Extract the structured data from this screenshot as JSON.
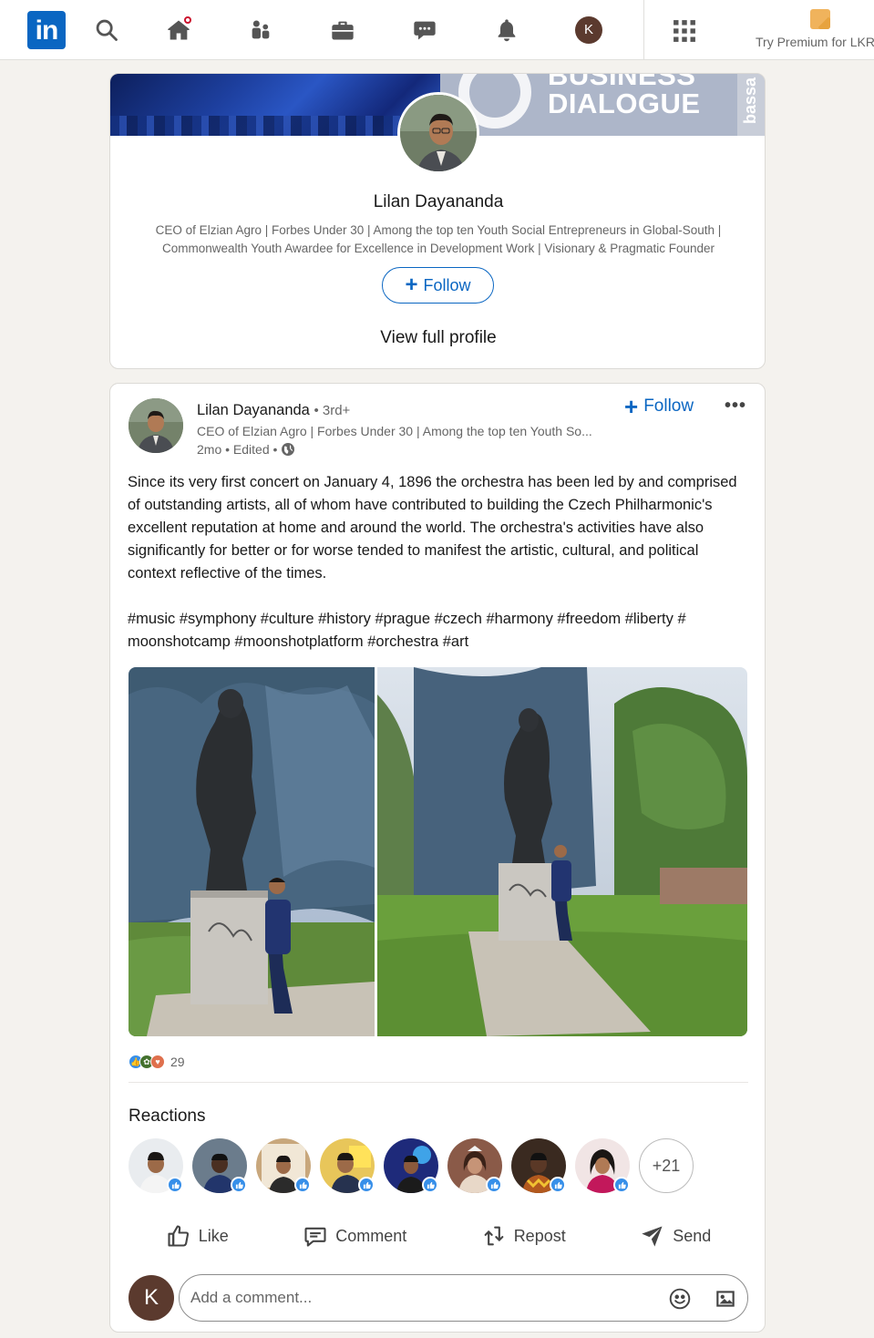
{
  "nav": {
    "logo_text": "in",
    "premium_text": "Try Premium for LKR",
    "avatar_letter": "K",
    "icons": [
      "search-icon",
      "home-icon",
      "my-network-icon",
      "jobs-icon",
      "messaging-icon",
      "notifications-icon",
      "grid-icon"
    ]
  },
  "profile_card": {
    "banner_text_1": "BUSINESS",
    "banner_text_2": "DIALOGUE",
    "banner_side_text": "bassa",
    "name": "Lilan Dayananda",
    "headline": "CEO of Elzian Agro | Forbes Under 30 | Among the top ten Youth Social Entrepreneurs in Global-South | Commonwealth Youth Awardee for Excellence in Development Work | Visionary & Pragmatic Founder",
    "follow_label": "Follow",
    "view_profile_label": "View full profile"
  },
  "post": {
    "author": "Lilan Dayananda",
    "degree": "• 3rd+",
    "headline": "CEO of Elzian Agro | Forbes Under 30 | Among the top ten Youth So...",
    "meta": "2mo • Edited •",
    "follow_label": "Follow",
    "more_label": "•••",
    "body_p1": "Since its very first concert on January 4, 1896 the orchestra has been led by and comprised of outstanding artists, all of whom have contributed to building the Czech Philharmonic's excellent reputation at home and around the world. The orchestra's activities have also significantly for better or for worse tended to manifest the artistic, cultural, and political context reflective of the times.",
    "body_p2": "#music #symphony #culture #history #prague #czech #harmony #freedom #liberty # moonshotcamp #moonshotplatform #orchestra #art",
    "reaction_count": "29",
    "reactions_title": "Reactions",
    "more_reactors": "+21",
    "actions": {
      "like": "Like",
      "comment": "Comment",
      "repost": "Repost",
      "send": "Send"
    },
    "comment_avatar_letter": "K",
    "comment_placeholder": "Add a comment..."
  },
  "colors": {
    "brand": "#0a66c2",
    "background": "#f4f2ee",
    "like_blue": "#378fe9"
  }
}
